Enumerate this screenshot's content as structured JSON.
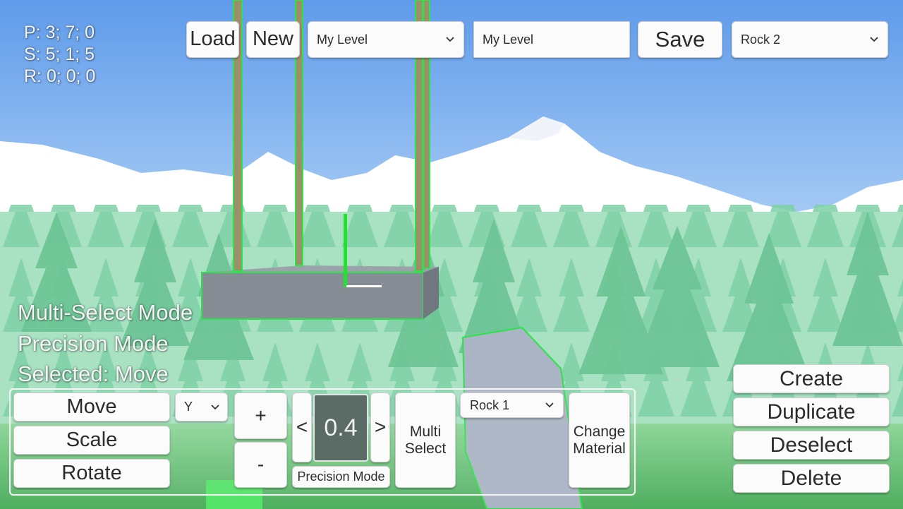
{
  "hud": {
    "position": "P: 3; 7; 0",
    "scale": "S: 5; 1; 5",
    "rotation": "R: 0; 0; 0",
    "multi_select_mode": "Multi-Select Mode",
    "precision_mode": "Precision Mode",
    "selected": "Selected: Move"
  },
  "toolbar": {
    "load_label": "Load",
    "new_label": "New",
    "level_dropdown": "My Level",
    "level_name_value": "My Level",
    "save_label": "Save",
    "object_dropdown": "Rock 2"
  },
  "transform_panel": {
    "move_label": "Move",
    "scale_label": "Scale",
    "rotate_label": "Rotate",
    "axis_dropdown": "Y",
    "plus_label": "+",
    "minus_label": "-",
    "decrease_label": "<",
    "increase_label": ">",
    "step_value": "0.4",
    "precision_mode_label": "Precision Mode",
    "multi_select_label_1": "Multi",
    "multi_select_label_2": "Select",
    "material_dropdown": "Rock 1",
    "change_material_label_1": "Change",
    "change_material_label_2": "Material"
  },
  "actions": {
    "create_label": "Create",
    "duplicate_label": "Duplicate",
    "deselect_label": "Deselect",
    "delete_label": "Delete"
  },
  "icons": {
    "dropdown_chevron": "chevron-down-icon"
  },
  "colors": {
    "selection_outline": "#2ee34a",
    "sky_top": "#5f9bea",
    "sky_bottom": "#d6e8fb"
  }
}
